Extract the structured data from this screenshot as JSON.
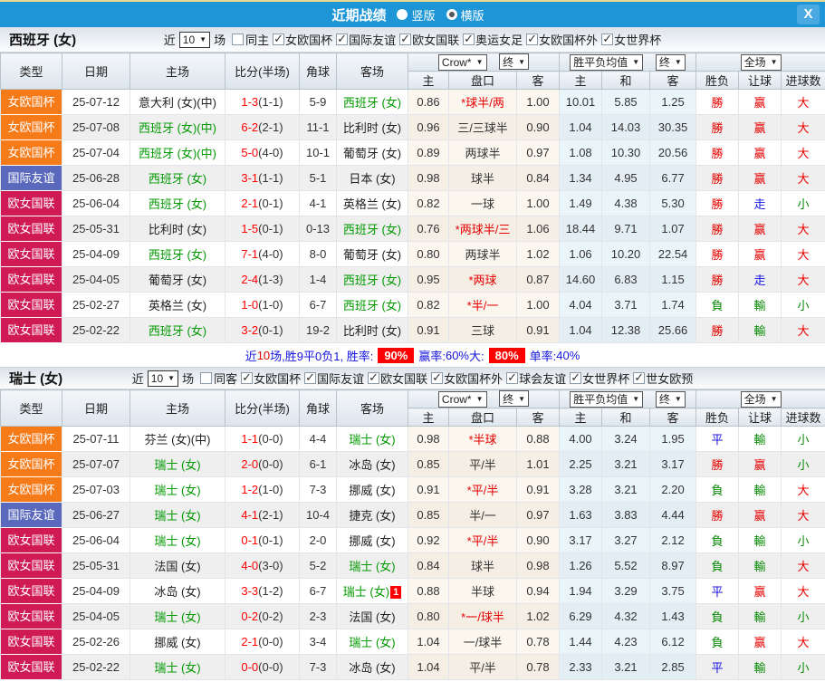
{
  "header": {
    "title": "近期战绩",
    "radio_vertical_label": "竖版",
    "radio_horizontal_label": "横版",
    "selected_layout": "horizontal",
    "close_label": "X"
  },
  "filter_labels": {
    "near": "近",
    "games": "场"
  },
  "table_header": {
    "cols": [
      "类型",
      "日期",
      "主场",
      "比分(半场)",
      "角球",
      "客场"
    ],
    "dropdown_company": "Crow*",
    "dropdown_final1": "终",
    "dropdown_avg": "胜平负均值",
    "dropdown_final2": "终",
    "dropdown_scope": "全场",
    "arrow": "▼",
    "sub": [
      "主",
      "盘口",
      "客",
      "主",
      "和",
      "客",
      "胜负",
      "让球",
      "进球数"
    ]
  },
  "colors": {
    "topbar": "#1d95d6",
    "team_green": "#009900",
    "score_red": "#ff0000",
    "badge_red": "#ff0000",
    "type_colors": {
      "女欧国杯": "#f57a18",
      "国际友谊": "#5a69bc",
      "欧女国联": "#cf1a55"
    },
    "result_colors": {
      "勝": "#e60000",
      "赢": "#e60000",
      "大": "#e60000",
      "負": "#068a06",
      "輸": "#068a06",
      "小": "#068a06",
      "平": "#1414e6",
      "走": "#1414e6"
    }
  },
  "sections": [
    {
      "title": "西班牙 (女)",
      "near_value": "10",
      "same_label": "同主",
      "same_checked": false,
      "competitions": [
        "女欧国杯",
        "国际友谊",
        "欧女国联",
        "奥运女足",
        "女欧国杯外",
        "女世界杯"
      ],
      "rows": [
        {
          "type": "女欧国杯",
          "date": "25-07-12",
          "home": "意大利 (女)(中)",
          "home_green": false,
          "score": "1-3",
          "half": "(1-1)",
          "corner": "5-9",
          "away": "西班牙 (女)",
          "away_green": true,
          "away_note": "",
          "odds": [
            "0.86",
            "*球半/两",
            "1.00"
          ],
          "handicap_red": true,
          "avg": [
            "10.01",
            "5.85",
            "1.25"
          ],
          "results": [
            "勝",
            "赢",
            "大"
          ]
        },
        {
          "type": "女欧国杯",
          "date": "25-07-08",
          "home": "西班牙 (女)(中)",
          "home_green": true,
          "score": "6-2",
          "half": "(2-1)",
          "corner": "11-1",
          "away": "比利时 (女)",
          "away_green": false,
          "away_note": "",
          "odds": [
            "0.96",
            "三/三球半",
            "0.90"
          ],
          "handicap_red": false,
          "avg": [
            "1.04",
            "14.03",
            "30.35"
          ],
          "results": [
            "勝",
            "赢",
            "大"
          ]
        },
        {
          "type": "女欧国杯",
          "date": "25-07-04",
          "home": "西班牙 (女)(中)",
          "home_green": true,
          "score": "5-0",
          "half": "(4-0)",
          "corner": "10-1",
          "away": "葡萄牙 (女)",
          "away_green": false,
          "away_note": "",
          "odds": [
            "0.89",
            "两球半",
            "0.97"
          ],
          "handicap_red": false,
          "avg": [
            "1.08",
            "10.30",
            "20.56"
          ],
          "results": [
            "勝",
            "赢",
            "大"
          ]
        },
        {
          "type": "国际友谊",
          "date": "25-06-28",
          "home": "西班牙 (女)",
          "home_green": true,
          "score": "3-1",
          "half": "(1-1)",
          "corner": "5-1",
          "away": "日本 (女)",
          "away_green": false,
          "away_note": "",
          "odds": [
            "0.98",
            "球半",
            "0.84"
          ],
          "handicap_red": false,
          "avg": [
            "1.34",
            "4.95",
            "6.77"
          ],
          "results": [
            "勝",
            "赢",
            "大"
          ]
        },
        {
          "type": "欧女国联",
          "date": "25-06-04",
          "home": "西班牙 (女)",
          "home_green": true,
          "score": "2-1",
          "half": "(0-1)",
          "corner": "4-1",
          "away": "英格兰 (女)",
          "away_green": false,
          "away_note": "",
          "odds": [
            "0.82",
            "一球",
            "1.00"
          ],
          "handicap_red": false,
          "avg": [
            "1.49",
            "4.38",
            "5.30"
          ],
          "results": [
            "勝",
            "走",
            "小"
          ]
        },
        {
          "type": "欧女国联",
          "date": "25-05-31",
          "home": "比利时 (女)",
          "home_green": false,
          "score": "1-5",
          "half": "(0-1)",
          "corner": "0-13",
          "away": "西班牙 (女)",
          "away_green": true,
          "away_note": "",
          "odds": [
            "0.76",
            "*两球半/三",
            "1.06"
          ],
          "handicap_red": true,
          "avg": [
            "18.44",
            "9.71",
            "1.07"
          ],
          "results": [
            "勝",
            "赢",
            "大"
          ]
        },
        {
          "type": "欧女国联",
          "date": "25-04-09",
          "home": "西班牙 (女)",
          "home_green": true,
          "score": "7-1",
          "half": "(4-0)",
          "corner": "8-0",
          "away": "葡萄牙 (女)",
          "away_green": false,
          "away_note": "",
          "odds": [
            "0.80",
            "两球半",
            "1.02"
          ],
          "handicap_red": false,
          "avg": [
            "1.06",
            "10.20",
            "22.54"
          ],
          "results": [
            "勝",
            "赢",
            "大"
          ]
        },
        {
          "type": "欧女国联",
          "date": "25-04-05",
          "home": "葡萄牙 (女)",
          "home_green": false,
          "score": "2-4",
          "half": "(1-3)",
          "corner": "1-4",
          "away": "西班牙 (女)",
          "away_green": true,
          "away_note": "",
          "odds": [
            "0.95",
            "*两球",
            "0.87"
          ],
          "handicap_red": true,
          "avg": [
            "14.60",
            "6.83",
            "1.15"
          ],
          "results": [
            "勝",
            "走",
            "大"
          ]
        },
        {
          "type": "欧女国联",
          "date": "25-02-27",
          "home": "英格兰 (女)",
          "home_green": false,
          "score": "1-0",
          "half": "(1-0)",
          "corner": "6-7",
          "away": "西班牙 (女)",
          "away_green": true,
          "away_note": "",
          "odds": [
            "0.82",
            "*半/一",
            "1.00"
          ],
          "handicap_red": true,
          "avg": [
            "4.04",
            "3.71",
            "1.74"
          ],
          "results": [
            "負",
            "輸",
            "小"
          ]
        },
        {
          "type": "欧女国联",
          "date": "25-02-22",
          "home": "西班牙 (女)",
          "home_green": true,
          "score": "3-2",
          "half": "(0-1)",
          "corner": "19-2",
          "away": "比利时 (女)",
          "away_green": false,
          "away_note": "",
          "odds": [
            "0.91",
            "三球",
            "0.91"
          ],
          "handicap_red": false,
          "avg": [
            "1.04",
            "12.38",
            "25.66"
          ],
          "results": [
            "勝",
            "輸",
            "大"
          ]
        }
      ],
      "summary": {
        "parts": [
          {
            "text": "近",
            "style": "blue"
          },
          {
            "text": "10",
            "style": "red"
          },
          {
            "text": "场,胜9平0负1, 胜率:",
            "style": "blue"
          },
          {
            "text": "90%",
            "style": "badge"
          },
          {
            "text": "赢率:",
            "style": "blue"
          },
          {
            "text": "60%",
            "style": "blue"
          },
          {
            "text": " 大:",
            "style": "blue"
          },
          {
            "text": "80%",
            "style": "badge"
          },
          {
            "text": "单率:",
            "style": "blue"
          },
          {
            "text": "40%",
            "style": "blue"
          }
        ]
      }
    },
    {
      "title": "瑞士 (女)",
      "near_value": "10",
      "same_label": "同客",
      "same_checked": false,
      "competitions": [
        "女欧国杯",
        "国际友谊",
        "欧女国联",
        "女欧国杯外",
        "球会友谊",
        "女世界杯",
        "世女欧预"
      ],
      "rows": [
        {
          "type": "女欧国杯",
          "date": "25-07-11",
          "home": "芬兰 (女)(中)",
          "home_green": false,
          "score": "1-1",
          "half": "(0-0)",
          "corner": "4-4",
          "away": "瑞士 (女)",
          "away_green": true,
          "away_note": "",
          "odds": [
            "0.98",
            "*半球",
            "0.88"
          ],
          "handicap_red": true,
          "avg": [
            "4.00",
            "3.24",
            "1.95"
          ],
          "results": [
            "平",
            "輸",
            "小"
          ]
        },
        {
          "type": "女欧国杯",
          "date": "25-07-07",
          "home": "瑞士 (女)",
          "home_green": true,
          "score": "2-0",
          "half": "(0-0)",
          "corner": "6-1",
          "away": "冰岛 (女)",
          "away_green": false,
          "away_note": "",
          "odds": [
            "0.85",
            "平/半",
            "1.01"
          ],
          "handicap_red": false,
          "avg": [
            "2.25",
            "3.21",
            "3.17"
          ],
          "results": [
            "勝",
            "赢",
            "小"
          ]
        },
        {
          "type": "女欧国杯",
          "date": "25-07-03",
          "home": "瑞士 (女)",
          "home_green": true,
          "score": "1-2",
          "half": "(1-0)",
          "corner": "7-3",
          "away": "挪威 (女)",
          "away_green": false,
          "away_note": "",
          "odds": [
            "0.91",
            "*平/半",
            "0.91"
          ],
          "handicap_red": true,
          "avg": [
            "3.28",
            "3.21",
            "2.20"
          ],
          "results": [
            "負",
            "輸",
            "大"
          ]
        },
        {
          "type": "国际友谊",
          "date": "25-06-27",
          "home": "瑞士 (女)",
          "home_green": true,
          "score": "4-1",
          "half": "(2-1)",
          "corner": "10-4",
          "away": "捷克 (女)",
          "away_green": false,
          "away_note": "",
          "odds": [
            "0.85",
            "半/一",
            "0.97"
          ],
          "handicap_red": false,
          "avg": [
            "1.63",
            "3.83",
            "4.44"
          ],
          "results": [
            "勝",
            "赢",
            "大"
          ]
        },
        {
          "type": "欧女国联",
          "date": "25-06-04",
          "home": "瑞士 (女)",
          "home_green": true,
          "score": "0-1",
          "half": "(0-1)",
          "corner": "2-0",
          "away": "挪威 (女)",
          "away_green": false,
          "away_note": "",
          "odds": [
            "0.92",
            "*平/半",
            "0.90"
          ],
          "handicap_red": true,
          "avg": [
            "3.17",
            "3.27",
            "2.12"
          ],
          "results": [
            "負",
            "輸",
            "小"
          ]
        },
        {
          "type": "欧女国联",
          "date": "25-05-31",
          "home": "法国 (女)",
          "home_green": false,
          "score": "4-0",
          "half": "(3-0)",
          "corner": "5-2",
          "away": "瑞士 (女)",
          "away_green": true,
          "away_note": "",
          "odds": [
            "0.84",
            "球半",
            "0.98"
          ],
          "handicap_red": false,
          "avg": [
            "1.26",
            "5.52",
            "8.97"
          ],
          "results": [
            "負",
            "輸",
            "大"
          ]
        },
        {
          "type": "欧女国联",
          "date": "25-04-09",
          "home": "冰岛 (女)",
          "home_green": false,
          "score": "3-3",
          "half": "(1-2)",
          "corner": "6-7",
          "away": "瑞士 (女)",
          "away_green": true,
          "away_note": "1",
          "odds": [
            "0.88",
            "半球",
            "0.94"
          ],
          "handicap_red": false,
          "avg": [
            "1.94",
            "3.29",
            "3.75"
          ],
          "results": [
            "平",
            "赢",
            "大"
          ]
        },
        {
          "type": "欧女国联",
          "date": "25-04-05",
          "home": "瑞士 (女)",
          "home_green": true,
          "score": "0-2",
          "half": "(0-2)",
          "corner": "2-3",
          "away": "法国 (女)",
          "away_green": false,
          "away_note": "",
          "odds": [
            "0.80",
            "*一/球半",
            "1.02"
          ],
          "handicap_red": true,
          "avg": [
            "6.29",
            "4.32",
            "1.43"
          ],
          "results": [
            "負",
            "輸",
            "小"
          ]
        },
        {
          "type": "欧女国联",
          "date": "25-02-26",
          "home": "挪威 (女)",
          "home_green": false,
          "score": "2-1",
          "half": "(0-0)",
          "corner": "3-4",
          "away": "瑞士 (女)",
          "away_green": true,
          "away_note": "",
          "odds": [
            "1.04",
            "一/球半",
            "0.78"
          ],
          "handicap_red": false,
          "avg": [
            "1.44",
            "4.23",
            "6.12"
          ],
          "results": [
            "負",
            "赢",
            "大"
          ]
        },
        {
          "type": "欧女国联",
          "date": "25-02-22",
          "home": "瑞士 (女)",
          "home_green": true,
          "score": "0-0",
          "half": "(0-0)",
          "corner": "7-3",
          "away": "冰岛 (女)",
          "away_green": false,
          "away_note": "",
          "odds": [
            "1.04",
            "平/半",
            "0.78"
          ],
          "handicap_red": false,
          "avg": [
            "2.33",
            "3.21",
            "2.85"
          ],
          "results": [
            "平",
            "輸",
            "小"
          ]
        }
      ],
      "summary": null
    }
  ]
}
